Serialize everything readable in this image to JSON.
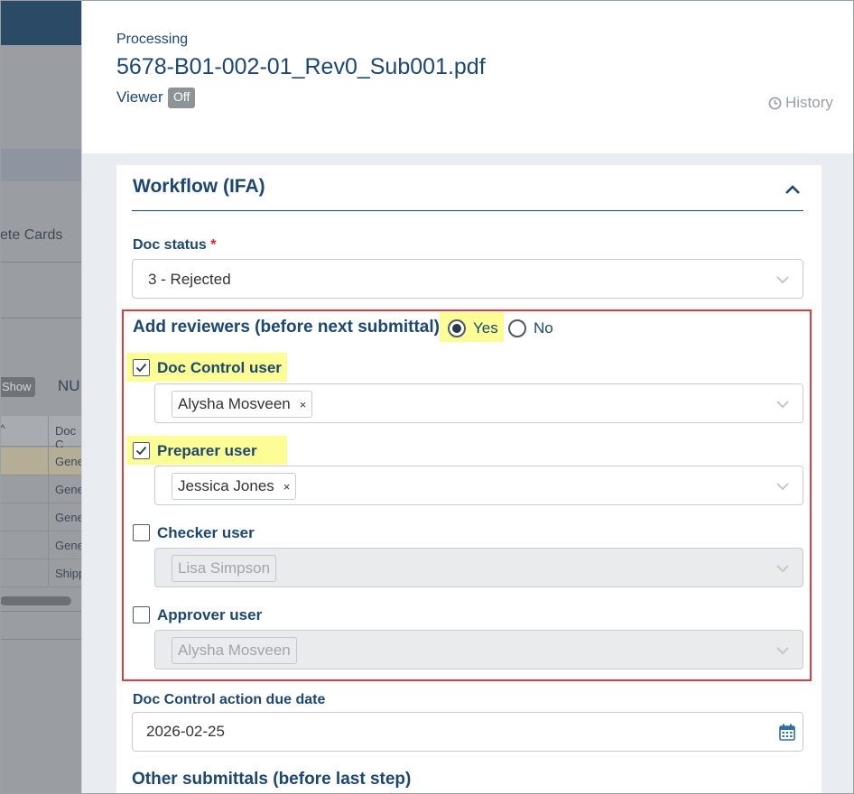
{
  "background": {
    "cards_tab_label": "ete Cards",
    "show_button_label": "Show",
    "nu_label": "NU",
    "column_header": "Doc C",
    "rows": [
      "Gene",
      "Gene",
      "Gene",
      "Gene",
      "Shipp"
    ]
  },
  "header": {
    "processing_label": "Processing",
    "file_title": "5678-B01-002-01_Rev0_Sub001.pdf",
    "viewer_label": "Viewer",
    "viewer_toggle": "Off",
    "history_label": "History",
    "history_icon": "clock-icon"
  },
  "workflow": {
    "section_title": "Workflow (IFA)",
    "collapse_icon": "chevron-up-icon",
    "doc_status": {
      "label": "Doc status",
      "required_marker": "*",
      "value": "3 - Rejected"
    },
    "add_reviewers": {
      "label": "Add reviewers (before next submittal)",
      "options": [
        "Yes",
        "No"
      ],
      "selected": "Yes"
    },
    "reviewers": [
      {
        "label": "Doc Control user",
        "checked": true,
        "user": "Alysha Mosveen",
        "enabled": true
      },
      {
        "label": "Preparer user",
        "checked": true,
        "user": "Jessica Jones",
        "enabled": true
      },
      {
        "label": "Checker user",
        "checked": false,
        "user": "Lisa Simpson",
        "enabled": false
      },
      {
        "label": "Approver user",
        "checked": false,
        "user": "Alysha Mosveen",
        "enabled": false
      }
    ],
    "tag_remove_symbol": "×",
    "due_date": {
      "label": "Doc Control action due date",
      "value": "2026-02-25",
      "icon": "calendar-icon"
    },
    "other_submittals_label": "Other submittals (before last step)"
  },
  "colors": {
    "primary_text": "#1b4770",
    "highlight": "#fdfd95",
    "annotation_box": "#e23b3f",
    "required": "#d9262c"
  }
}
